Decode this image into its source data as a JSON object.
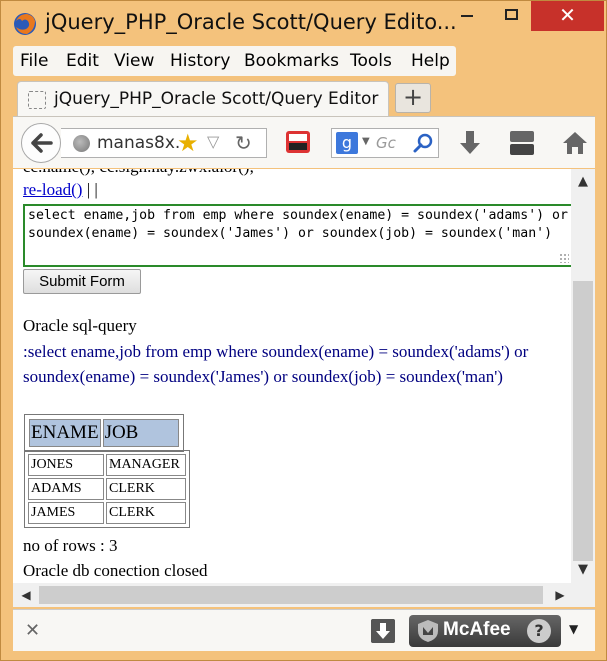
{
  "window": {
    "title": "jQuery_PHP_Oracle Scott/Query Edito...",
    "close_symbol": "✕"
  },
  "menu": {
    "items": [
      "File",
      "Edit",
      "View",
      "History",
      "Bookmarks",
      "Tools",
      "Help"
    ]
  },
  "tab": {
    "title": "jQuery_PHP_Oracle Scott/Query Editor",
    "new_tab_symbol": "+"
  },
  "navbar": {
    "url": "manas8x.",
    "search_engine_letter": "g",
    "search_placeholder": "Gc"
  },
  "content": {
    "cut_line": "cc.name(); cc.sign.nay.zwx.alor();",
    "reload_label": "re-load()",
    "reload_suffix": "| |",
    "query_text": "select ename,job from emp where soundex(ename) = soundex('adams') or soundex(ename) = soundex('James') or soundex(job) = soundex('man')",
    "submit_label": "Submit Form",
    "heading": "Oracle sql-query",
    "query_echo": ":select ename,job from emp where soundex(ename) = soundex('adams') or soundex(ename) = soundex('James') or soundex(job) = soundex('man')",
    "columns": [
      "ENAME",
      "JOB"
    ],
    "rows": [
      [
        "JONES",
        "MANAGER"
      ],
      [
        "ADAMS",
        "CLERK"
      ],
      [
        "JAMES",
        "CLERK"
      ]
    ],
    "rows_count": "no of rows : 3",
    "db_status": "Oracle db conection closed"
  },
  "addonbar": {
    "close_symbol": "✕",
    "mcafee_label": "McAfee",
    "help_symbol": "?"
  },
  "colors": {
    "accent_close": "#c7312a",
    "query_border": "#2a8a2a",
    "link": "#0000cc",
    "echo_text": "#000080",
    "table_header": "#b0c4de"
  }
}
